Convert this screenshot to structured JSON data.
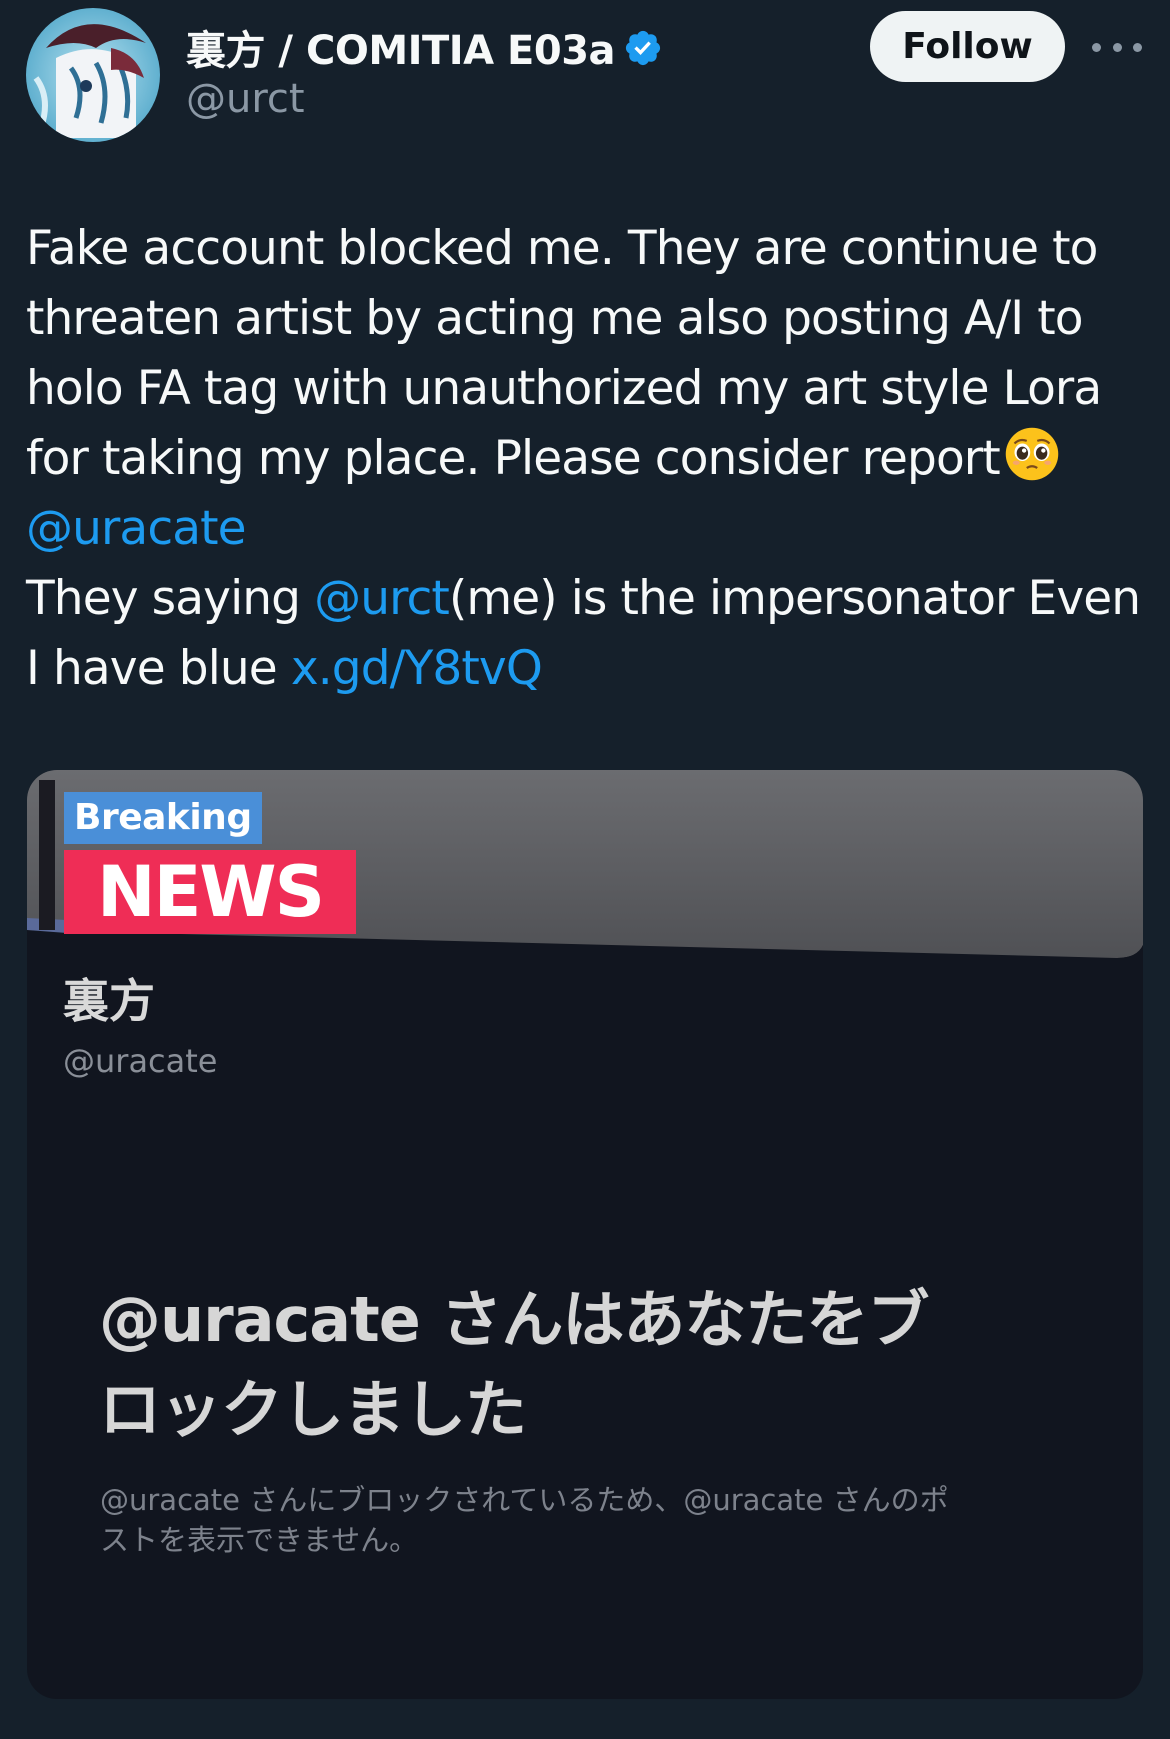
{
  "author": {
    "display_name": "裏方 / COMITIA E03a",
    "handle": "@urct",
    "verified": true
  },
  "actions": {
    "follow_label": "Follow"
  },
  "tweet": {
    "line1": "Fake account blocked me. They are continue to",
    "line2": "threaten artist by acting me also posting A/I to",
    "line3": "holo FA tag with unauthorized my art style Lora",
    "line4": "for taking my place. Please consider report",
    "emoji": "pleading-face",
    "mention_uracate": "@uracate",
    "line6_prefix": "They saying ",
    "mention_urct": "@urct",
    "line6_suffix": "(me) is the impersonator Even",
    "line7_prefix": "I have blue ",
    "link_text": "x.gd/Y8tvQ"
  },
  "media": {
    "breaking_label": "Breaking",
    "news_label": "NEWS",
    "profile_name": "裏方",
    "profile_handle": "@uracate",
    "blocked_title_line1": "@uracate さんはあなたをブ",
    "blocked_title_line2": "ロックしました",
    "blocked_sub_line1": "@uracate さんにブロックされているため、@uracate さんのポ",
    "blocked_sub_line2": "ストを表示できません。"
  },
  "colors": {
    "background": "#15202b",
    "link": "#1d9bf0",
    "verified": "#1d9bf0",
    "news_red": "#ef2d56",
    "breaking_blue": "#4a8fd8"
  }
}
